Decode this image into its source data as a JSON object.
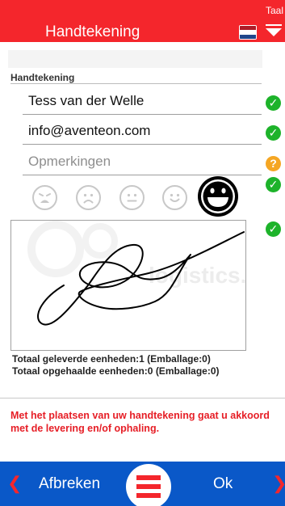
{
  "header": {
    "title": "Handtekening",
    "lang_label": "Taal",
    "flag_colors": [
      "#ae1c28",
      "#ffffff",
      "#21468b"
    ],
    "brand_color": "#f4262c"
  },
  "section": {
    "title": "Handtekening"
  },
  "form": {
    "name": "Tess van der Welle",
    "email": "info@aventeon.com",
    "remarks_value": "",
    "remarks_placeholder": "Opmerkingen"
  },
  "icons": {
    "valid": "check-circle-icon",
    "pending": "question-circle-icon",
    "check_glyph": "✓",
    "question_glyph": "?"
  },
  "rating": {
    "faces": [
      "very-sad-face-icon",
      "sad-face-icon",
      "neutral-face-icon",
      "happy-face-icon",
      "very-happy-face-icon"
    ],
    "selected": 5
  },
  "signature": {
    "watermark": "logistics.one"
  },
  "totals": {
    "delivered": "Totaal geleverde eenheden:1 (Emballage:0)",
    "collected": "Totaal opgehaalde eenheden:0 (Emballage:0)"
  },
  "agreement_text": "Met het plaatsen van uw handtekening gaat u akkoord met de levering en/of ophaling.",
  "footer": {
    "cancel_label": "Afbreken",
    "ok_label": "Ok",
    "left_arrow": "❮",
    "right_arrow": "❯",
    "bar_color": "#0a58c8"
  }
}
